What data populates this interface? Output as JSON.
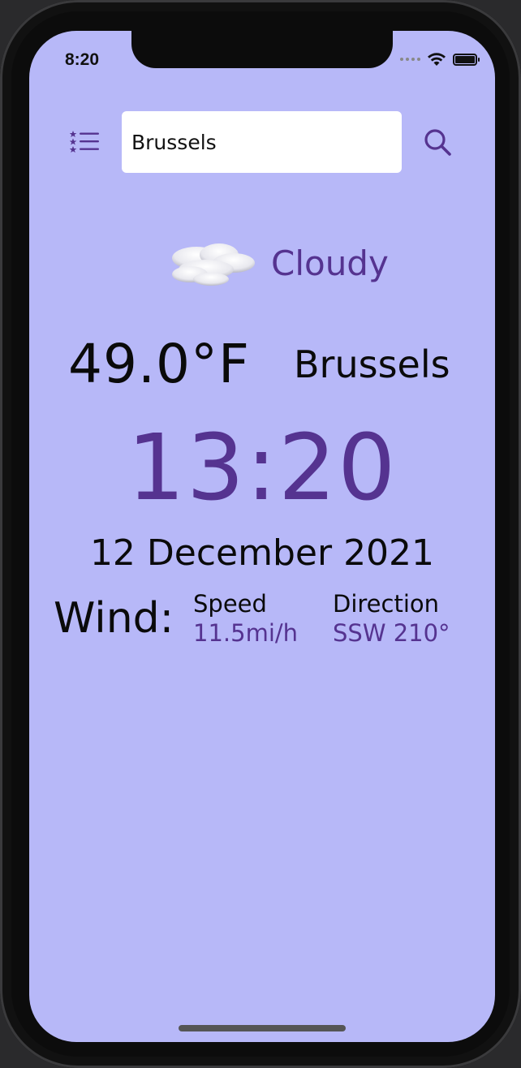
{
  "status_bar": {
    "time": "8:20"
  },
  "header": {
    "search_value": "Brussels",
    "menu_icon": "list-icon",
    "search_icon": "search-icon"
  },
  "weather": {
    "condition": "Cloudy",
    "condition_icon": "cloud-icon",
    "temperature": "49.0°F",
    "city": "Brussels",
    "local_time": "13:20",
    "date": "12 December 2021"
  },
  "wind": {
    "label": "Wind:",
    "speed_title": "Speed",
    "speed_value": "11.5mi/h",
    "direction_title": "Direction",
    "direction_value": "SSW 210°"
  },
  "colors": {
    "background": "#b7b8f8",
    "accent": "#553390",
    "text": "#0a0a0a"
  }
}
